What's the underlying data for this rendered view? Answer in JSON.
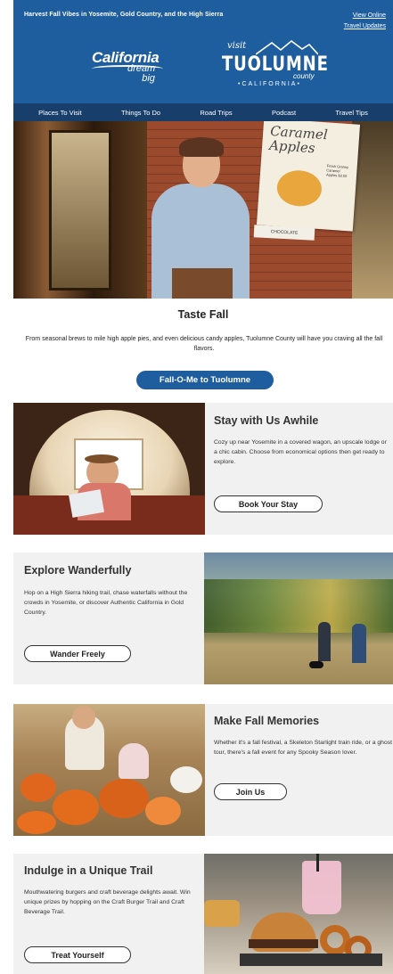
{
  "header": {
    "pretext": "Harvest Fall Vibes in Yosemite, Gold Country, and the High Sierra",
    "view_online": "View Online",
    "travel_updates": "Travel Updates",
    "california_logo": {
      "main": "California",
      "sub1": "dream",
      "sub2": "big"
    },
    "tuolumne_logo": {
      "visit": "visit",
      "main": "TUOLUMNE",
      "county": "county",
      "state": "•CALIFORNIA•"
    }
  },
  "nav": {
    "items": [
      {
        "label": "Places To Visit"
      },
      {
        "label": "Things To Do"
      },
      {
        "label": "Road Trips"
      },
      {
        "label": "Podcast"
      },
      {
        "label": "Travel Tips"
      }
    ]
  },
  "hero": {
    "sign_text": "Caramel Apples",
    "sign_small": "Fresh Granny Caramel Apples $3.50",
    "brand": "CHOCOLATE"
  },
  "intro": {
    "title": "Taste Fall",
    "text": "From seasonal brews to mile high apple pies, and even delicious candy apples, Tuolumne County will have you craving all the fall flavors.",
    "cta": "Fall-O-Me to Tuolumne"
  },
  "blocks": [
    {
      "title": "Stay with Us Awhile",
      "text": "Cozy up near Yosemite in a covered wagon, an upscale lodge or a chic cabin. Choose from economical options then get ready to explore.",
      "button": "Book Your Stay"
    },
    {
      "title": "Explore Wanderfully",
      "text": "Hop on a High Sierra hiking trail, chase waterfalls without the crowds in Yosemite, or discover Authentic California in Gold Country.",
      "button": "Wander Freely"
    },
    {
      "title": "Make Fall Memories",
      "text": "Whether it's a fall festival, a Skeleton Starlight train ride, or a ghost tour, there's a fall event for any Spooky Season lover.",
      "button": "Join Us"
    },
    {
      "title": "Indulge in a Unique Trail",
      "text": "Mouthwatering burgers and craft beverage delights await. Win unique prizes by hopping on the Craft Burger Trail and Craft Beverage Trail.",
      "button": "Treat Yourself"
    }
  ],
  "colors": {
    "brand_blue": "#1f5e9e",
    "nav_blue": "#183f6b",
    "block_bg": "#f1f1f1"
  }
}
